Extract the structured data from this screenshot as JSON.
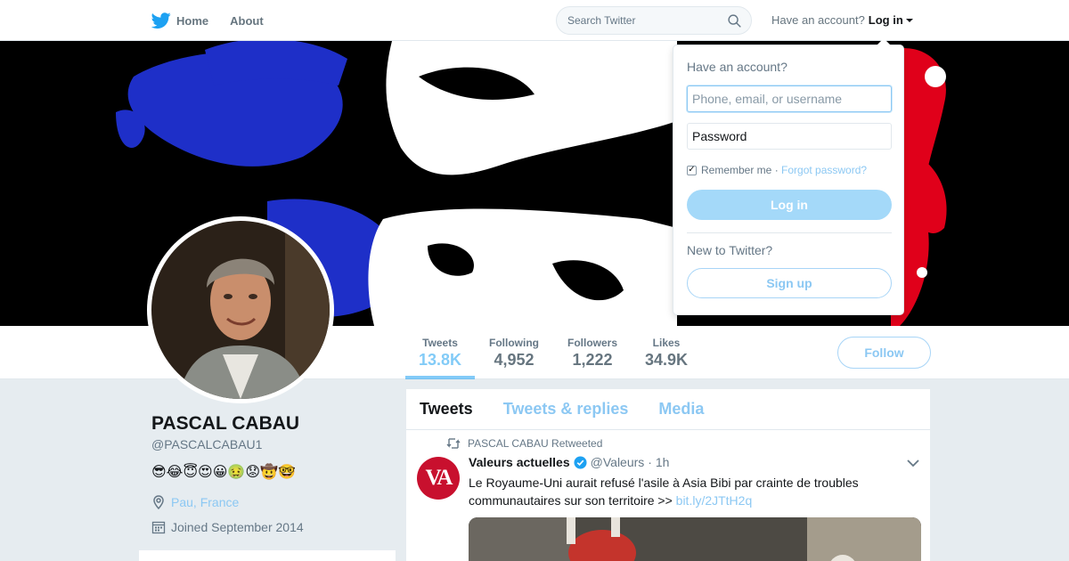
{
  "nav": {
    "home_label": "Home",
    "about_label": "About",
    "search_placeholder": "Search Twitter",
    "account_prompt": "Have an account?",
    "login_label": "Log in"
  },
  "profile": {
    "name": "PASCAL CABAU",
    "handle": "@PASCALCABAU1",
    "bio_emojis": "😎😂😇😍😀🤢😟🤠🤓",
    "location": "Pau, France",
    "joined": "Joined September 2014"
  },
  "stats": [
    {
      "label": "Tweets",
      "value": "13.8K"
    },
    {
      "label": "Following",
      "value": "4,952"
    },
    {
      "label": "Followers",
      "value": "1,222"
    },
    {
      "label": "Likes",
      "value": "34.9K"
    }
  ],
  "follow_label": "Follow",
  "timeline": {
    "tabs": [
      "Tweets",
      "Tweets & replies",
      "Media"
    ],
    "retweet_label": "PASCAL CABAU Retweeted",
    "tweet": {
      "avatar_text": "VA",
      "author": "Valeurs actuelles",
      "handle": "@Valeurs",
      "time": "· 1h",
      "text": "Le Royaume-Uni aurait refusé l'asile à Asia Bibi par crainte de troubles communautaires sur son territoire >> ",
      "link": "bit.ly/2JTtH2q"
    }
  },
  "login_dropdown": {
    "title": "Have an account?",
    "username_placeholder": "Phone, email, or username",
    "password_placeholder": "Password",
    "remember_label": "Remember me",
    "separator": " · ",
    "forgot_label": "Forgot password?",
    "login_button": "Log in",
    "new_prompt": "New to Twitter?",
    "signup_button": "Sign up"
  },
  "colors": {
    "accent": "#1da1f2",
    "banner_blue": "#1e2fc8",
    "banner_red": "#e0001a"
  }
}
